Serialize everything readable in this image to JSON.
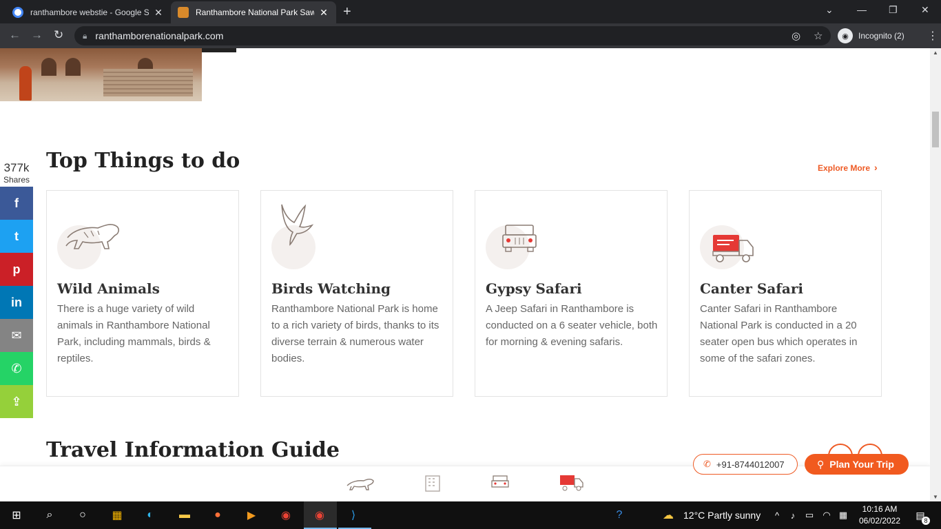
{
  "browser": {
    "tabs": [
      {
        "title": "ranthambore webstie - Google Se",
        "active": false
      },
      {
        "title": "Ranthambore National Park Sawa",
        "active": true
      }
    ],
    "new_tab": "+",
    "url": "ranthamborenationalpark.com",
    "profile_label": "Incognito (2)"
  },
  "share": {
    "count": "377k",
    "label": "Shares",
    "buttons": [
      {
        "name": "facebook",
        "glyph": "f",
        "color": "#3b5998"
      },
      {
        "name": "twitter",
        "glyph": "t",
        "color": "#1da1f2"
      },
      {
        "name": "pinterest",
        "glyph": "p",
        "color": "#cb2027"
      },
      {
        "name": "linkedin",
        "glyph": "in",
        "color": "#0077b5"
      },
      {
        "name": "email",
        "glyph": "✉",
        "color": "#848484"
      },
      {
        "name": "whatsapp",
        "glyph": "✆",
        "color": "#25d366"
      },
      {
        "name": "share",
        "glyph": "⇪",
        "color": "#95d03a"
      }
    ]
  },
  "top_things": {
    "title": "Top Things to do",
    "explore_label": "Explore More",
    "cards": [
      {
        "title": "Wild Animals",
        "text": "There is a huge variety of wild animals in Ranthambore National Park, including mammals, birds & reptiles.",
        "icon": "tiger-icon"
      },
      {
        "title": "Birds Watching",
        "text": "Ranthambore National Park is home to a rich variety of birds, thanks to its diverse terrain & numerous water bodies.",
        "icon": "bird-icon"
      },
      {
        "title": "Gypsy Safari",
        "text": "A Jeep Safari in Ranthambore is conducted on a 6 seater vehicle, both for morning & evening safaris.",
        "icon": "jeep-icon"
      },
      {
        "title": "Canter Safari",
        "text": "Canter Safari in Ranthambore National Park is conducted in a 20 seater open bus which operates in some of the safari zones.",
        "icon": "truck-icon"
      }
    ]
  },
  "travel_guide": {
    "title": "Travel Information Guide"
  },
  "contact": {
    "phone": "+91-8744012007",
    "plan_label": "Plan Your Trip"
  },
  "taskbar": {
    "weather": "12°C  Partly sunny",
    "time": "10:16 AM",
    "date": "06/02/2022",
    "notifications": "8"
  },
  "colors": {
    "accent": "#f15a1f",
    "chrome_dark": "#202124"
  }
}
